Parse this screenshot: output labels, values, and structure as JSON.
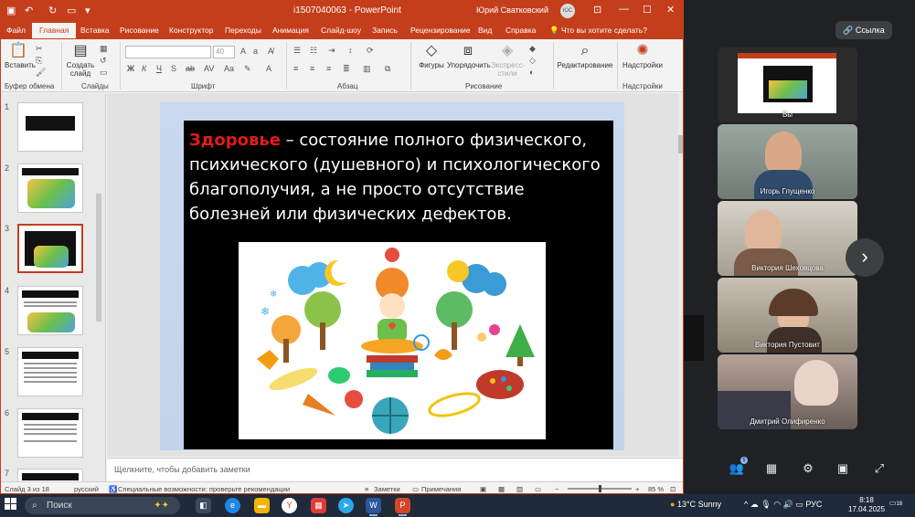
{
  "titlebar": {
    "doc_title": "i1507040063 - PowerPoint",
    "user": "Юрий Сватковский",
    "user_initials": "ЮС"
  },
  "tabs": [
    "Файл",
    "Главная",
    "Вставка",
    "Рисование",
    "Конструктор",
    "Переходы",
    "Анимация",
    "Слайд-шоу",
    "Запись",
    "Рецензирование",
    "Вид",
    "Справка"
  ],
  "tell_me": "Что вы хотите сделать?",
  "ribbon": {
    "paste": "Вставить",
    "new_slide": "Создать слайд",
    "font_size": "40",
    "shapes": "Фигуры",
    "arrange": "Упорядочить",
    "quick_styles": "Экспресс-стили",
    "editing": "Редактирование",
    "addins": "Надстройки",
    "groups": {
      "clipboard": "Буфер обмена",
      "slides": "Слайды",
      "font": "Шрифт",
      "paragraph": "Абзац",
      "drawing": "Рисование",
      "addins": "Надстройки"
    }
  },
  "thumbnails": [
    {
      "num": "1"
    },
    {
      "num": "2"
    },
    {
      "num": "3"
    },
    {
      "num": "4"
    },
    {
      "num": "5"
    },
    {
      "num": "6"
    },
    {
      "num": "7"
    }
  ],
  "slide": {
    "keyword": "Здоровье",
    "definition": " – состояние полного физического, психического (душевного) и психологического благополучия, а не просто отсутствие болезней или физических дефектов."
  },
  "notes_placeholder": "Щелкните, чтобы добавить заметки",
  "statusbar": {
    "slide_info": "Слайд 3 из 18",
    "language": "русский",
    "accessibility": "Специальные возможности: проверьте рекомендации",
    "notes": "Заметки",
    "comments": "Примечания",
    "zoom": "85 %"
  },
  "call": {
    "link_button": "Ссылка",
    "shared_label": "Вы",
    "participants": [
      {
        "name": "Игорь Глущенко"
      },
      {
        "name": "Виктория Шеховцова"
      },
      {
        "name": "Виктория Пустовит"
      },
      {
        "name": "Дмитрий Олифиренко"
      }
    ],
    "people_badge": "5"
  },
  "taskbar": {
    "search": "Поиск",
    "weather": "13°C  Sunny",
    "lang": "РУС",
    "time": "8:18",
    "date": "17.04.2025",
    "notif_count": "18"
  }
}
